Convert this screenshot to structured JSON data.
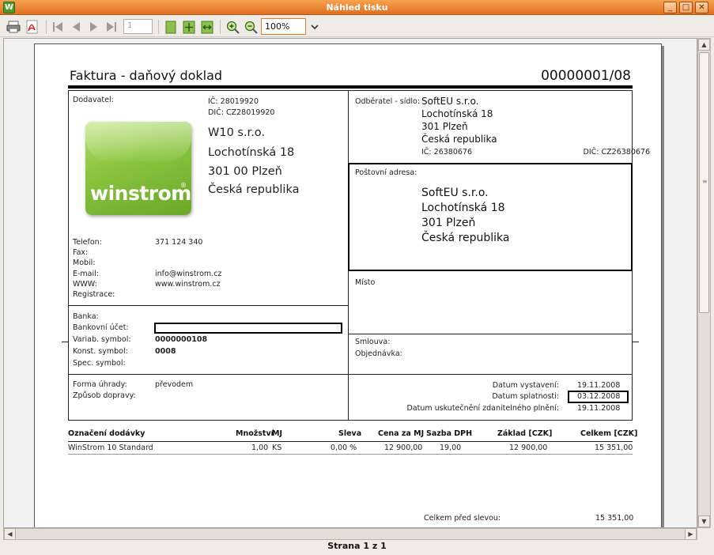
{
  "window": {
    "title": "Náhled tisku",
    "app_icon": "W"
  },
  "toolbar": {
    "page_number": "1",
    "zoom": "100%"
  },
  "status": {
    "page_label": "Strana 1 z 1"
  },
  "invoice": {
    "title": "Faktura - daňový doklad",
    "number": "00000001/08",
    "supplier": {
      "label": "Dodavatel:",
      "ic": "IČ: 28019920",
      "dic": "DIČ: CZ28019920",
      "name": "W10 s.r.o.",
      "street": "Lochotínská 18",
      "city": "301 00  Plzeň",
      "country": "Česká republika",
      "logo_text": "winstrom",
      "logo_mark": "®"
    },
    "contacts": {
      "phone_label": "Telefon:",
      "phone": "371 124 340",
      "fax_label": "Fax:",
      "mobile_label": "Mobil:",
      "email_label": "E-mail:",
      "email": "info@winstrom.cz",
      "www_label": "WWW:",
      "www": "www.winstrom.cz",
      "registration_label": "Registrace:"
    },
    "bank": {
      "bank_label": "Banka:",
      "account_label": "Bankovní účet:",
      "variable_label": "Variab. symbol:",
      "variable": "0000000108",
      "constant_label": "Konst. symbol:",
      "constant": "0008",
      "specific_label": "Spec. symbol:"
    },
    "payment": {
      "method_label": "Forma úhrady:",
      "method": "převodem",
      "delivery_label": "Způsob dopravy:"
    },
    "customer": {
      "label": "Odběratel - sídlo:",
      "name": "SoftEU s.r.o.",
      "street": "Lochotínská 18",
      "city": "301  Plzeň",
      "country": "Česká republika",
      "ic": "IČ: 26380676",
      "dic": "DIČ: CZ26380676"
    },
    "postal": {
      "label": "Poštovní adresa:",
      "name": "SoftEU s.r.o.",
      "street": "Lochotínská 18",
      "city": "301 Plzeň",
      "country": "Česká republika"
    },
    "place_label": "Místo",
    "contract_label": "Smlouva:",
    "order_label": "Objednávka:",
    "dates": {
      "issued_label": "Datum vystavení:",
      "issued": "19.11.2008",
      "due_label": "Datum splatnosti:",
      "due": "03.12.2008",
      "taxable_label": "Datum uskutečnění zdanitelného plnění:",
      "taxable": "19.11.2008"
    },
    "table": {
      "headers": [
        "Označení dodávky",
        "Množství",
        "MJ",
        "Sleva",
        "Cena za MJ",
        "Sazba DPH",
        "Základ [CZK]",
        "Celkem [CZK]"
      ],
      "rows": [
        [
          "WinStrom 10 Standard",
          "1,00",
          "KS",
          "0,00 %",
          "12 900,00",
          "19,00",
          "12 900,00",
          "15 351,00"
        ]
      ]
    },
    "total_before_discount_label": "Celkem  před slevou:",
    "total_before_discount": "15 351,00"
  }
}
